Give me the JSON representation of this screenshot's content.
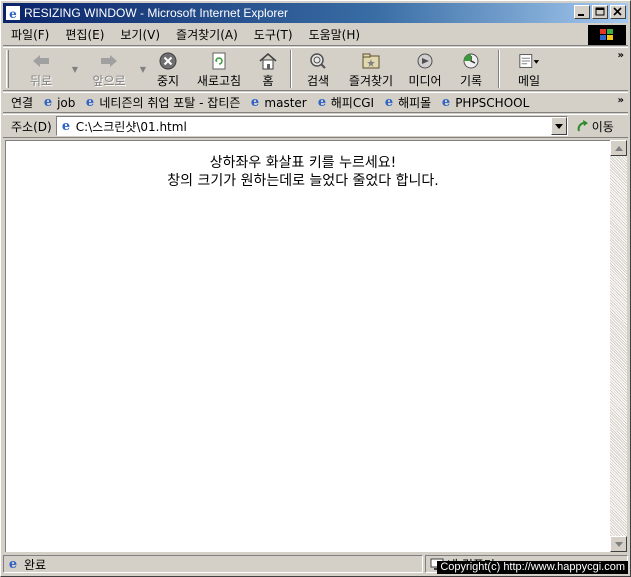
{
  "window": {
    "title": "RESIZING WINDOW - Microsoft Internet Explorer"
  },
  "menu": {
    "items": [
      "파일(F)",
      "편집(E)",
      "보기(V)",
      "즐겨찾기(A)",
      "도구(T)",
      "도움말(H)"
    ]
  },
  "toolbar": {
    "back": "뒤로",
    "forward": "앞으로",
    "stop": "중지",
    "refresh": "새로고침",
    "home": "홈",
    "search": "검색",
    "favorites": "즐겨찾기",
    "media": "미디어",
    "history": "기록",
    "mail": "메일",
    "more": "»"
  },
  "links": {
    "label": "연결",
    "items": [
      "job",
      "네티즌의 취업 포탈 - 잡티즌",
      "master",
      "해피CGI",
      "해피몰",
      "PHPSCHOOL"
    ],
    "more": "»"
  },
  "address": {
    "label": "주소(D)",
    "value": "C:\\스크린샷\\01.html",
    "go_label": "이동"
  },
  "content": {
    "line1": "상하좌우 화살표 키를 누르세요!",
    "line2": "창의 크기가 원하는데로 늘었다 줄었다 합니다."
  },
  "status": {
    "text": "완료",
    "zone": "내 컴퓨터"
  },
  "watermark": "Copyright(c) http://www.happycgi.com",
  "colors": {
    "titlebar_start": "#0a246a",
    "titlebar_end": "#a6caf0",
    "chrome": "#d4d0c8",
    "ie_blue": "#2f64c8"
  }
}
